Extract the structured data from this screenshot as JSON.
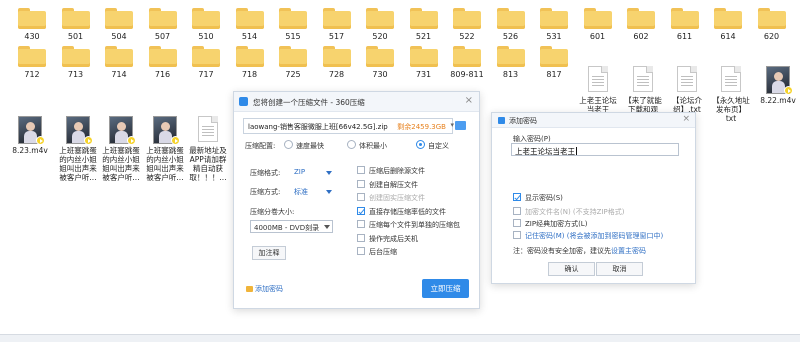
{
  "desktop": {
    "row1_folders": [
      "430",
      "501",
      "504",
      "507",
      "510",
      "514",
      "515",
      "517",
      "520",
      "521",
      "522",
      "526",
      "531",
      "601",
      "602",
      "611",
      "614",
      "620"
    ],
    "row2_folders": [
      "712",
      "713",
      "714",
      "716",
      "717",
      "718",
      "725",
      "728",
      "730",
      "731",
      "809-811",
      "813",
      "817"
    ],
    "row2_files": [
      {
        "label_lines": [
          "上老王论坛",
          "当老王"
        ],
        "kind": "doc"
      },
      {
        "label_lines": [
          "【来了就能",
          "下载和观",
          "看！纯免",
          "费！】.txt"
        ],
        "kind": "doc"
      },
      {
        "label_lines": [
          "【论坛介",
          "绍】.txt"
        ],
        "kind": "doc"
      },
      {
        "label_lines": [
          "【永久地址",
          "发布页】",
          "txt"
        ],
        "kind": "doc"
      },
      {
        "label_lines": [
          "8.22.m4v"
        ],
        "kind": "video"
      }
    ],
    "row3_files": [
      {
        "label_lines": [
          "8.23.m4v"
        ],
        "kind": "video"
      },
      {
        "label_lines": [
          "上班塞跳蛋",
          "的内丝小姐",
          "姐叫出声来",
          "被客户听..."
        ],
        "kind": "video"
      },
      {
        "label_lines": [
          "上班塞跳蛋",
          "的内丝小姐",
          "姐叫出声来",
          "被客户听..."
        ],
        "kind": "video"
      },
      {
        "label_lines": [
          "上班塞跳蛋",
          "的内丝小姐",
          "姐叫出声来",
          "被客户听..."
        ],
        "kind": "video"
      },
      {
        "label_lines": [
          "最新地址及",
          "APP请加群",
          "精自动获",
          "取！！！..."
        ],
        "kind": "doc"
      }
    ]
  },
  "zip_dialog": {
    "title": "您将创建一个压缩文件 - 360压缩",
    "close": "×",
    "filename": "laowang-销售客服微服上班[66v42.5G].zip",
    "free_space": "剩余2459.3GB",
    "config_label": "压缩配置:",
    "modes": [
      "速度最快",
      "体积最小",
      "自定义"
    ],
    "selected_mode": "自定义",
    "format_label": "压缩格式:",
    "format_value": "ZIP",
    "method_label": "压缩方式:",
    "method_value": "标准",
    "split_label": "压缩分卷大小:",
    "split_value": "4000MB - DVD刻录",
    "explain_button": "加注释",
    "options": [
      {
        "label": "压缩后删除源文件",
        "checked": false,
        "disabled": false
      },
      {
        "label": "创建自解压文件",
        "checked": false,
        "disabled": false
      },
      {
        "label": "创建固实压缩文件",
        "checked": false,
        "disabled": true
      },
      {
        "label": "直接存储压缩率低的文件",
        "checked": true,
        "disabled": false
      },
      {
        "label": "压缩每个文件到单独的压缩包",
        "checked": false,
        "disabled": false
      },
      {
        "label": "操作完成后关机",
        "checked": false,
        "disabled": false
      },
      {
        "label": "后台压缩",
        "checked": false,
        "disabled": false
      }
    ],
    "add_password": "添加密码",
    "start_button": "立即压缩"
  },
  "password_dialog": {
    "title": "添加密码",
    "close": "×",
    "input_label": "输入密码(P)",
    "input_value": "上老王论坛当老王",
    "options": [
      {
        "label": "显示密码(S)",
        "checked": true,
        "disabled": false
      },
      {
        "label": "加密文件名(N) (不支持ZIP格式)",
        "checked": false,
        "disabled": true
      },
      {
        "label": "ZIP经典加密方式(L)",
        "checked": false,
        "disabled": false
      },
      {
        "label": "记住密码(M) (将会被添加到密码管理窗口中)",
        "checked": false,
        "disabled": false,
        "link": true
      }
    ],
    "note_prefix": "注：密码没有安全加密，建议先",
    "note_link": "设置主密码",
    "ok": "确认",
    "cancel": "取消"
  }
}
